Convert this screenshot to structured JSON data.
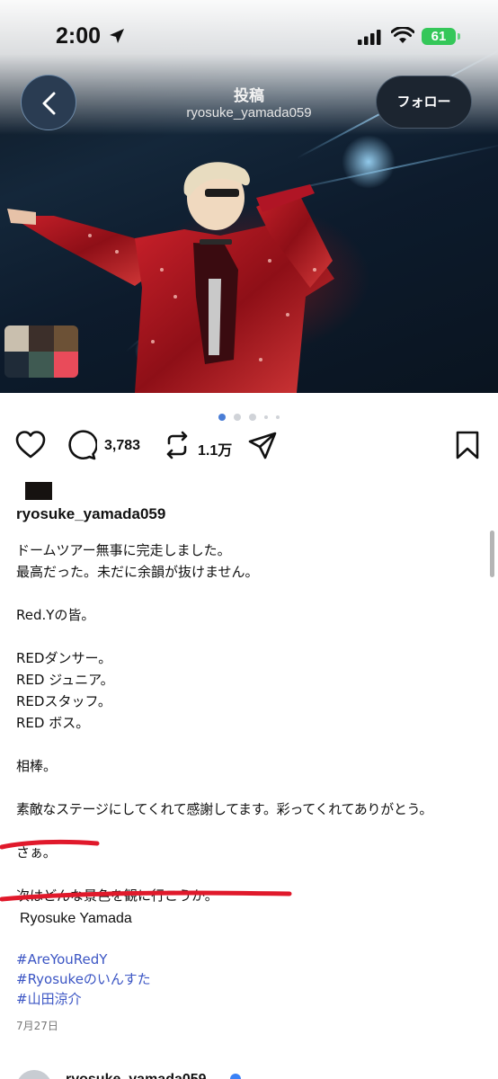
{
  "status_bar": {
    "time": "2:00",
    "battery": "61"
  },
  "nav": {
    "title": "投稿",
    "subtitle": "ryosuke_yamada059",
    "follow_label": "フォロー"
  },
  "carousel": {
    "total_dots": 5,
    "active_index": 0
  },
  "actions": {
    "comments": "3,783",
    "reposts": "1.1万"
  },
  "post": {
    "username": "ryosuke_yamada059",
    "caption_lines": [
      "ドームツアー無事に完走しました。",
      "最高だった。未だに余韻が抜けません。",
      "",
      "Red.Yの皆。",
      "",
      "REDダンサー。",
      "RED ジュニア。",
      "REDスタッフ。",
      "RED ボス。",
      "",
      "相棒。",
      "",
      "素敵なステージにしてくれて感謝してます。彩ってくれてありがとう。",
      "",
      "さぁ。",
      "",
      "次はどんな景色を観に行こうか。"
    ],
    "signature": "Ryosuke Yamada",
    "hashtags": [
      "#AreYouRedY",
      "#Ryosukeのいんすた",
      "#山田涼介"
    ],
    "date": "7月27日"
  },
  "next_post": {
    "username": "ryosuke_yamada059"
  },
  "colors": {
    "accent_link": "#3b55c4",
    "annotation_red": "#e0192b",
    "follow_bg": "#1c2530",
    "battery_green": "#34c759"
  },
  "icons": [
    "back-chevron-icon",
    "location-arrow-icon",
    "signal-icon",
    "wifi-icon",
    "battery-icon",
    "heart-icon",
    "comment-icon",
    "repost-icon",
    "share-icon",
    "bookmark-icon"
  ]
}
